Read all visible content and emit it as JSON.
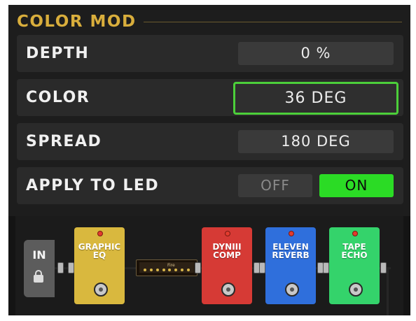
{
  "section": {
    "title": "COLOR MOD"
  },
  "params": [
    {
      "label": "DEPTH",
      "value": "0 %"
    },
    {
      "label": "COLOR",
      "value": "36 DEG"
    },
    {
      "label": "SPREAD",
      "value": "180 DEG"
    }
  ],
  "apply_led": {
    "label": "APPLY TO LED",
    "off_label": "OFF",
    "on_label": "ON",
    "state": "ON"
  },
  "chain": {
    "input_label": "IN",
    "amp_logo": "Fire",
    "pedals": [
      {
        "name": "GRAPHIC\nEQ",
        "color": "#d9b83e"
      },
      {
        "name": "DYNIII\nCOMP",
        "color": "#d63a35"
      },
      {
        "name": "ELEVEN\nREVERB",
        "color": "#2f6fdc"
      },
      {
        "name": "TAPE\nECHO",
        "color": "#34d36b"
      }
    ]
  },
  "colors": {
    "accent": "#d9ae3c",
    "selected_border": "#4ccf3a",
    "on_green": "#2bdb25"
  }
}
